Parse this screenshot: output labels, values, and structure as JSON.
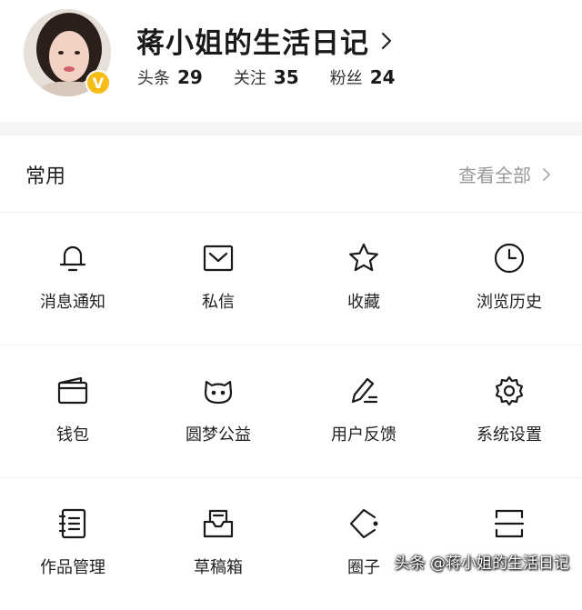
{
  "profile": {
    "name": "蒋小姐的生活日记",
    "badge": "V",
    "stats": [
      {
        "label": "头条",
        "value": "29"
      },
      {
        "label": "关注",
        "value": "35"
      },
      {
        "label": "粉丝",
        "value": "24"
      }
    ]
  },
  "section": {
    "title": "常用",
    "view_all": "查看全部"
  },
  "grid": [
    {
      "label": "消息通知",
      "icon": "bell-icon"
    },
    {
      "label": "私信",
      "icon": "mail-icon"
    },
    {
      "label": "收藏",
      "icon": "star-icon"
    },
    {
      "label": "浏览历史",
      "icon": "clock-icon"
    },
    {
      "label": "钱包",
      "icon": "wallet-icon"
    },
    {
      "label": "圆梦公益",
      "icon": "cat-face-icon"
    },
    {
      "label": "用户反馈",
      "icon": "pen-icon"
    },
    {
      "label": "系统设置",
      "icon": "gear-icon"
    },
    {
      "label": "作品管理",
      "icon": "notebook-icon"
    },
    {
      "label": "草稿箱",
      "icon": "inbox-icon"
    },
    {
      "label": "圈子",
      "icon": "circle-tag-icon"
    },
    {
      "label": "",
      "icon": "scan-icon"
    }
  ],
  "watermark": "头条 @蒋小姐的生活日记",
  "colors": {
    "badge": "#f6bd16",
    "muted": "#999999",
    "separator": "#f5f5f5"
  }
}
